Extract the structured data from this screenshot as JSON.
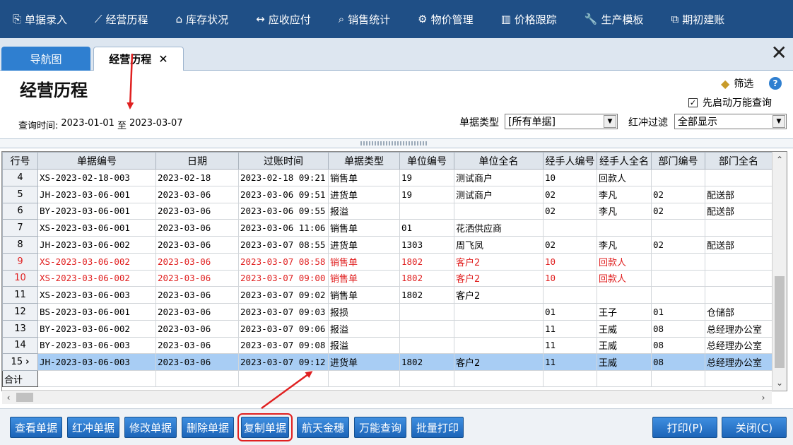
{
  "nav": {
    "items": [
      {
        "label": "单据录入",
        "icon": "⎘"
      },
      {
        "label": "经营历程",
        "icon": "⟋"
      },
      {
        "label": "库存状况",
        "icon": "⌂"
      },
      {
        "label": "应收应付",
        "icon": "↔"
      },
      {
        "label": "销售统计",
        "icon": "⌕"
      },
      {
        "label": "物价管理",
        "icon": "⚙"
      },
      {
        "label": "价格跟踪",
        "icon": "▥"
      },
      {
        "label": "生产模板",
        "icon": "🔧"
      },
      {
        "label": "期初建账",
        "icon": "⧉"
      }
    ]
  },
  "tabs": {
    "nav_label": "导航图",
    "history_label": "经营历程",
    "close_glyph": "✕"
  },
  "header": {
    "title": "经营历程",
    "filter_label": "筛选",
    "help_glyph": "?",
    "universal_query_label": "先启动万能查询",
    "universal_query_checked": "✓",
    "query_time_label": "查询时间:",
    "date_from": "2023-01-01",
    "date_to_label": "至",
    "date_to": "2023-03-07",
    "doc_type_label": "单据类型",
    "doc_type_value": "[所有单据]",
    "red_filter_label": "红冲过滤",
    "red_filter_value": "全部显示"
  },
  "table": {
    "columns": [
      "行号",
      "单据编号",
      "日期",
      "过账时间",
      "单据类型",
      "单位编号",
      "单位全名",
      "经手人编号",
      "经手人全名",
      "部门编号",
      "部门全名"
    ],
    "rows": [
      {
        "row": "4",
        "no": "XS-2023-02-18-003",
        "date": "2023-02-18",
        "post": "2023-02-18 09:21",
        "type": "销售单",
        "unit_no": "19",
        "unit": "测试商户",
        "emp_no": "10",
        "emp": "回款人",
        "dept_no": "",
        "dept": "",
        "status": "normal"
      },
      {
        "row": "5",
        "no": "JH-2023-03-06-001",
        "date": "2023-03-06",
        "post": "2023-03-06 09:51",
        "type": "进货单",
        "unit_no": "19",
        "unit": "测试商户",
        "emp_no": "02",
        "emp": "李凡",
        "dept_no": "02",
        "dept": "配送部",
        "status": "normal"
      },
      {
        "row": "6",
        "no": "BY-2023-03-06-001",
        "date": "2023-03-06",
        "post": "2023-03-06 09:55",
        "type": "报溢",
        "unit_no": "",
        "unit": "",
        "emp_no": "02",
        "emp": "李凡",
        "dept_no": "02",
        "dept": "配送部",
        "status": "normal"
      },
      {
        "row": "7",
        "no": "XS-2023-03-06-001",
        "date": "2023-03-06",
        "post": "2023-03-06 11:06",
        "type": "销售单",
        "unit_no": "01",
        "unit": "花洒供应商",
        "emp_no": "",
        "emp": "",
        "dept_no": "",
        "dept": "",
        "status": "normal"
      },
      {
        "row": "8",
        "no": "JH-2023-03-06-002",
        "date": "2023-03-06",
        "post": "2023-03-07 08:55",
        "type": "进货单",
        "unit_no": "1303",
        "unit": "周飞凤",
        "emp_no": "02",
        "emp": "李凡",
        "dept_no": "02",
        "dept": "配送部",
        "status": "normal"
      },
      {
        "row": "9",
        "no": "XS-2023-03-06-002",
        "date": "2023-03-06",
        "post": "2023-03-07 08:58",
        "type": "销售单",
        "unit_no": "1802",
        "unit": "客户2",
        "emp_no": "10",
        "emp": "回款人",
        "dept_no": "",
        "dept": "",
        "status": "red"
      },
      {
        "row": "10",
        "no": "XS-2023-03-06-002",
        "date": "2023-03-06",
        "post": "2023-03-07 09:00",
        "type": "销售单",
        "unit_no": "1802",
        "unit": "客户2",
        "emp_no": "10",
        "emp": "回款人",
        "dept_no": "",
        "dept": "",
        "status": "red"
      },
      {
        "row": "11",
        "no": "XS-2023-03-06-003",
        "date": "2023-03-06",
        "post": "2023-03-07 09:02",
        "type": "销售单",
        "unit_no": "1802",
        "unit": "客户2",
        "emp_no": "",
        "emp": "",
        "dept_no": "",
        "dept": "",
        "status": "normal"
      },
      {
        "row": "12",
        "no": "BS-2023-03-06-001",
        "date": "2023-03-06",
        "post": "2023-03-07 09:03",
        "type": "报损",
        "unit_no": "",
        "unit": "",
        "emp_no": "01",
        "emp": "王子",
        "dept_no": "01",
        "dept": "仓储部",
        "status": "normal"
      },
      {
        "row": "13",
        "no": "BY-2023-03-06-002",
        "date": "2023-03-06",
        "post": "2023-03-07 09:06",
        "type": "报溢",
        "unit_no": "",
        "unit": "",
        "emp_no": "11",
        "emp": "王威",
        "dept_no": "08",
        "dept": "总经理办公室",
        "status": "normal"
      },
      {
        "row": "14",
        "no": "BY-2023-03-06-003",
        "date": "2023-03-06",
        "post": "2023-03-07 09:08",
        "type": "报溢",
        "unit_no": "",
        "unit": "",
        "emp_no": "11",
        "emp": "王威",
        "dept_no": "08",
        "dept": "总经理办公室",
        "status": "normal"
      },
      {
        "row": "15",
        "no": "JH-2023-03-06-003",
        "date": "2023-03-06",
        "post": "2023-03-07 09:12",
        "type": "进货单",
        "unit_no": "1802",
        "unit": "客户2",
        "emp_no": "11",
        "emp": "王威",
        "dept_no": "08",
        "dept": "总经理办公室",
        "status": "selected",
        "marker": "›"
      }
    ],
    "total_label": "合计"
  },
  "buttons": {
    "view": "查看单据",
    "redflush": "红冲单据",
    "modify": "修改单据",
    "delete": "删除单据",
    "copy": "复制单据",
    "aerospace": "航天金穗",
    "universal": "万能查询",
    "batch_print": "批量打印",
    "print": "打印(P)",
    "close": "关闭(C)"
  },
  "colors": {
    "nav_bg": "#1f4f86",
    "accent": "#2f7fd0",
    "red_row": "#e02020",
    "selected_row": "#a8cdf4",
    "annotation": "#e02020"
  }
}
